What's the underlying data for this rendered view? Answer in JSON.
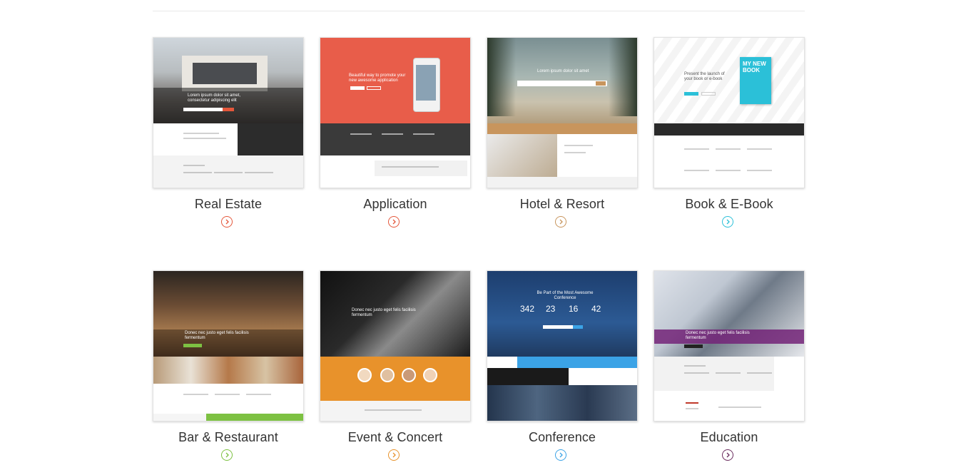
{
  "templates": [
    {
      "label": "Real Estate",
      "accent": "#e4573b",
      "hero_text": "Lorem ipsum dolor sit amet, consectetur adipiscing elit",
      "icon": "chevron-right-icon"
    },
    {
      "label": "Application",
      "accent": "#e4573b",
      "hero_text": "Beautiful way to promote your new awesome application",
      "icon": "chevron-right-icon"
    },
    {
      "label": "Hotel & Resort",
      "accent": "#c8955d",
      "hero_text": "Lorem ipsum dolor sit amet",
      "icon": "chevron-right-icon"
    },
    {
      "label": "Book & E-Book",
      "accent": "#2bc0d8",
      "hero_text": "Present the launch of your book or e-book",
      "book_title": "MY NEW BOOK",
      "icon": "chevron-right-icon"
    },
    {
      "label": "Bar & Restaurant",
      "accent": "#7dc142",
      "hero_text": "Donec nec justo eget felis facilisis fermentum",
      "icon": "chevron-right-icon"
    },
    {
      "label": "Event & Concert",
      "accent": "#e8922b",
      "hero_text": "Donec nec justo eget felis facilisis fermentum",
      "icon": "chevron-right-icon"
    },
    {
      "label": "Conference",
      "accent": "#3ba3e6",
      "hero_text": "Be Part of the Most Awesome Conference",
      "countdown": [
        "342",
        "23",
        "16",
        "42"
      ],
      "icon": "chevron-right-icon"
    },
    {
      "label": "Education",
      "accent": "#6a2c5e",
      "hero_text": "Donec nec justo eget felis facilisis fermentum",
      "icon": "chevron-right-icon"
    }
  ]
}
